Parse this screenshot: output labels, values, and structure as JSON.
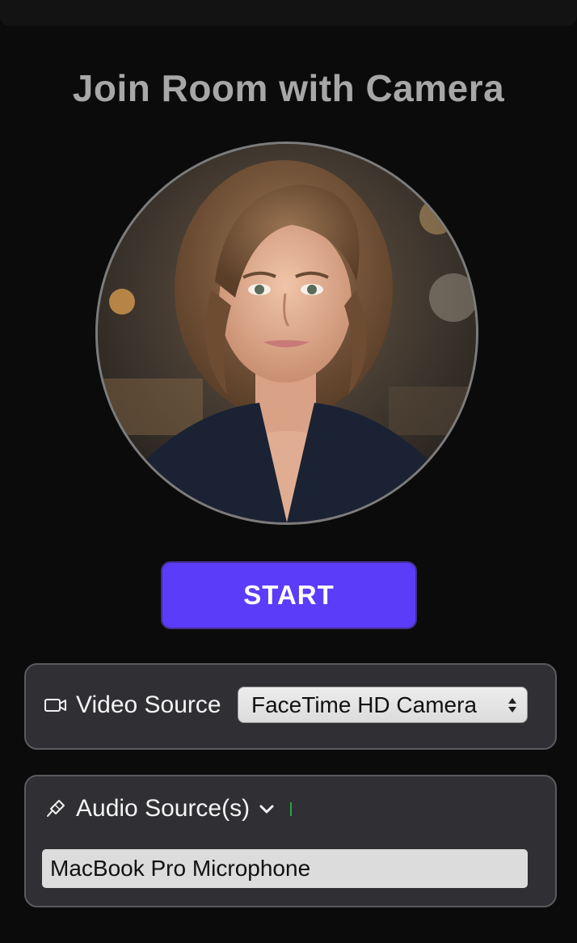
{
  "title": "Join Room with Camera",
  "start_button_label": "START",
  "video_source": {
    "icon": "video-camera-icon",
    "label": "Video Source",
    "selected": "FaceTime HD Camera"
  },
  "audio_source": {
    "icon": "microphone-icon",
    "label": "Audio Source(s)",
    "toggle_icon": "chevron-down-icon",
    "devices": [
      "MacBook Pro Microphone"
    ]
  },
  "colors": {
    "accent": "#5b3cf8",
    "level_meter": "#2ea043"
  }
}
